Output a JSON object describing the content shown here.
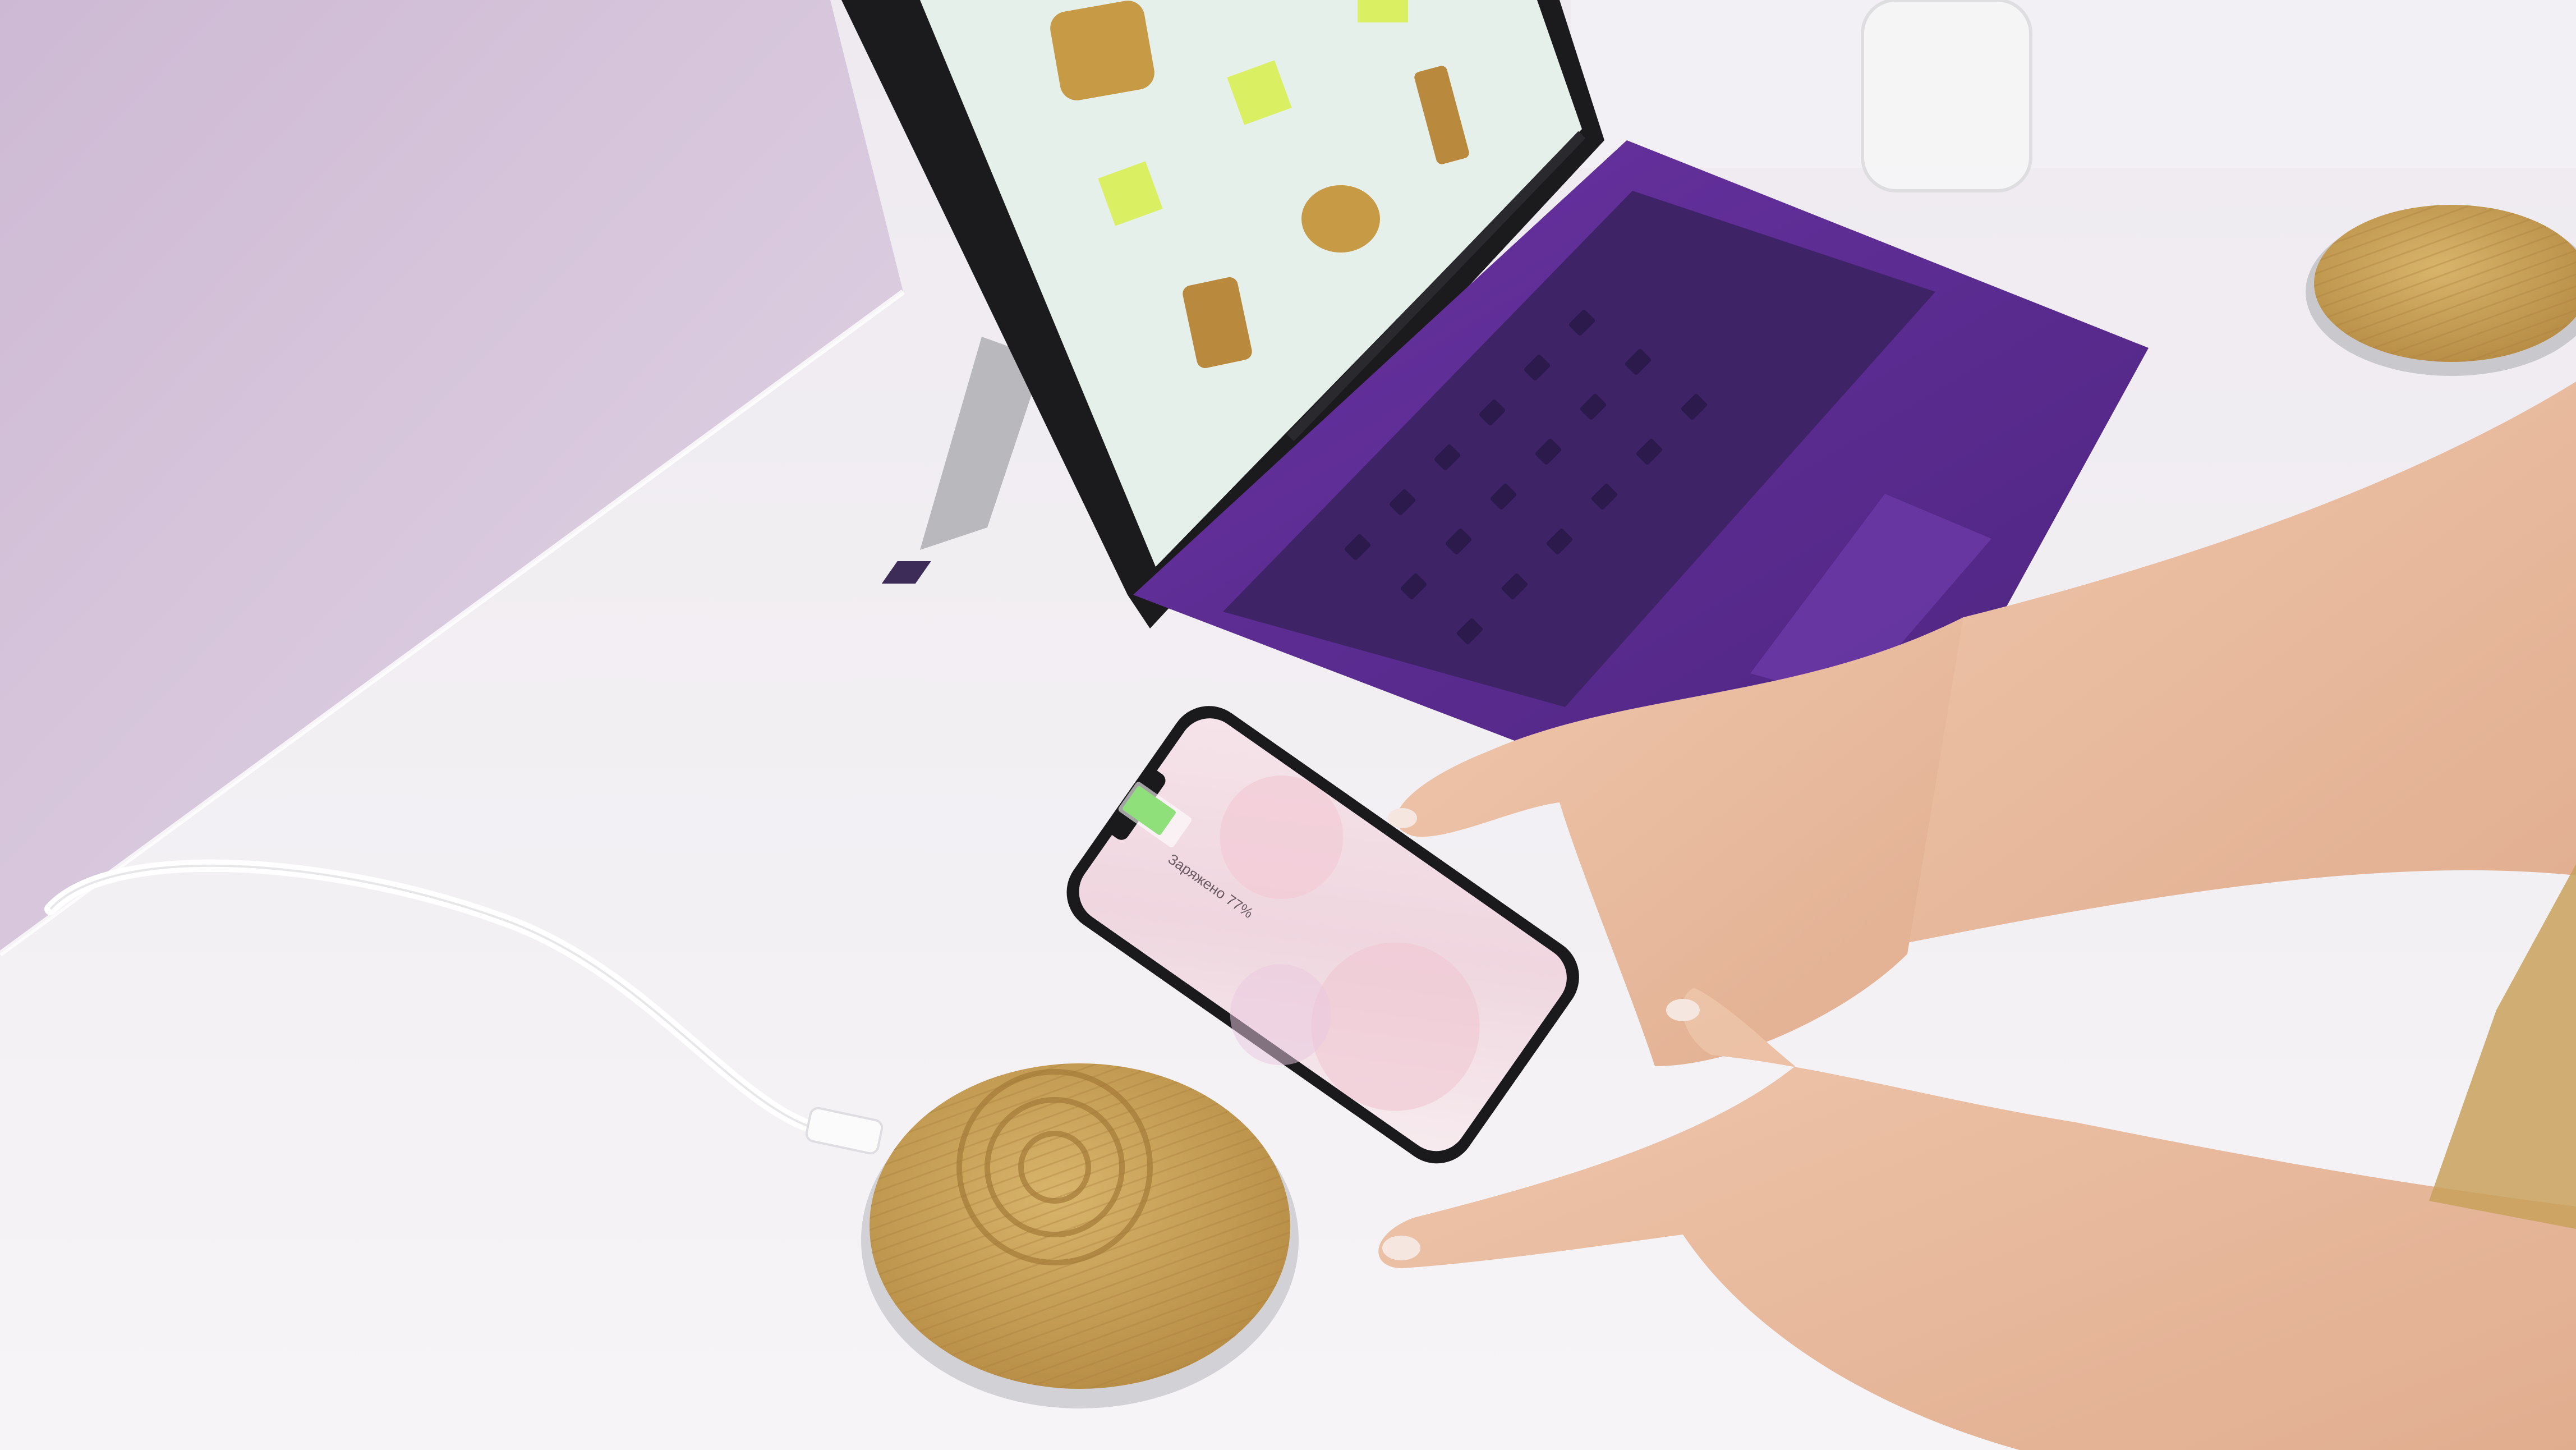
{
  "phone": {
    "charging_text": "Заряжено 77%",
    "battery_level": 0.77,
    "battery_color": "#8fe07a"
  },
  "colors": {
    "wall": "#d9c8de",
    "desk": "#f1eff2",
    "keyboard_cover": "#5b2a8f",
    "bamboo": "#c9a15a",
    "laptop_screen": "#e6f0ea",
    "accent_lime": "#d8ef4a"
  }
}
